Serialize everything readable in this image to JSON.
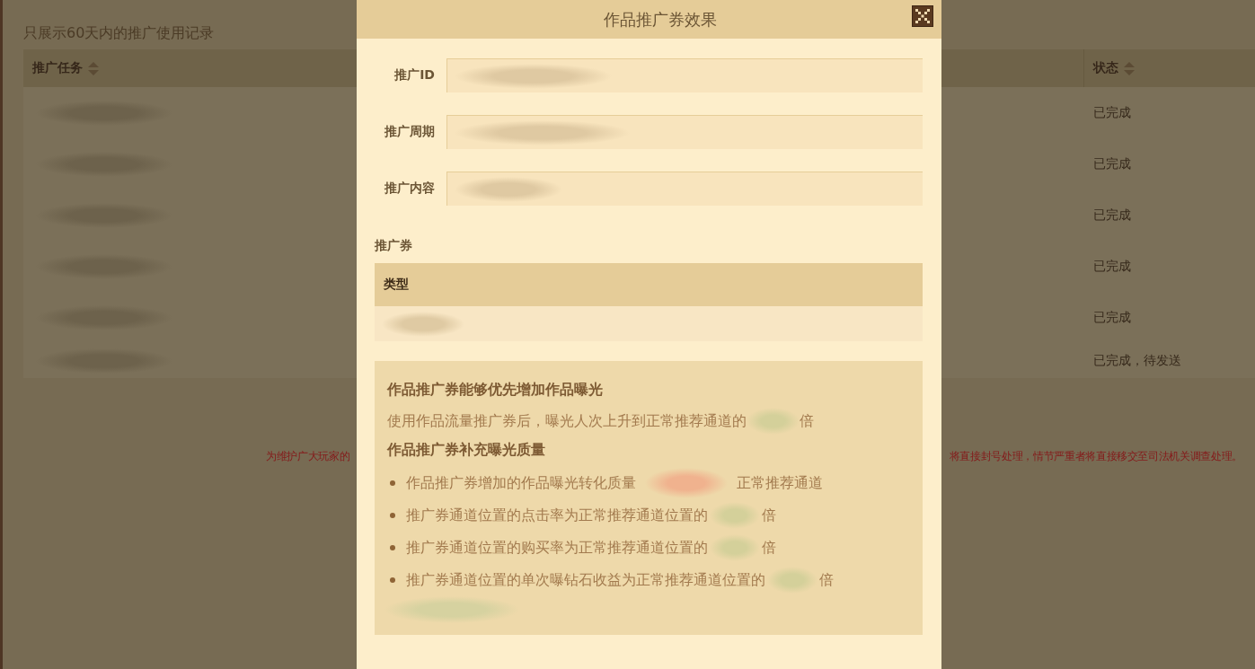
{
  "records": {
    "caption": "只展示60天内的推广使用记录",
    "table": {
      "columns": [
        {
          "label": "推广任务",
          "sortable": true
        },
        {
          "label": "状态",
          "sortable": true
        }
      ],
      "rows": [
        {
          "status": "已完成"
        },
        {
          "status": "已完成"
        },
        {
          "status": "已完成"
        },
        {
          "status": "已完成"
        },
        {
          "status": "已完成"
        },
        {
          "status": "已完成，待发送"
        }
      ]
    },
    "notice": {
      "left": "为维护广大玩家的",
      "right": "将直接封号处理，情节严重者将直接移交至司法机关调查处理。"
    }
  },
  "dialog": {
    "title": "作品推广券效果",
    "fields": [
      {
        "label": "推广ID"
      },
      {
        "label": "推广周期"
      },
      {
        "label": "推广内容"
      }
    ],
    "coupons": {
      "label": "推广券",
      "columns": [
        "类型"
      ]
    },
    "info": {
      "heading": "作品推广券能够优先增加作品曝光",
      "line": {
        "before": "使用作品流量推广券后，曝光人次上升到正常推荐通道的",
        "after": "倍"
      },
      "subheading": "作品推广券补充曝光质量",
      "bullets": [
        {
          "before": "作品推广券增加的作品曝光转化质量",
          "after": "正常推荐通道",
          "color": "#f0b28e"
        },
        {
          "before": "推广券通道位置的点击率为正常推荐通道位置的",
          "after": "倍",
          "color": "#d4d09a"
        },
        {
          "before": "推广券通道位置的购买率为正常推荐通道位置的",
          "after": "倍",
          "color": "#d4d09a"
        },
        {
          "before": "推广券通道位置的单次曝钻石收益为正常推荐通道位置的",
          "after": "倍",
          "color": "#d4d09a"
        }
      ]
    }
  }
}
